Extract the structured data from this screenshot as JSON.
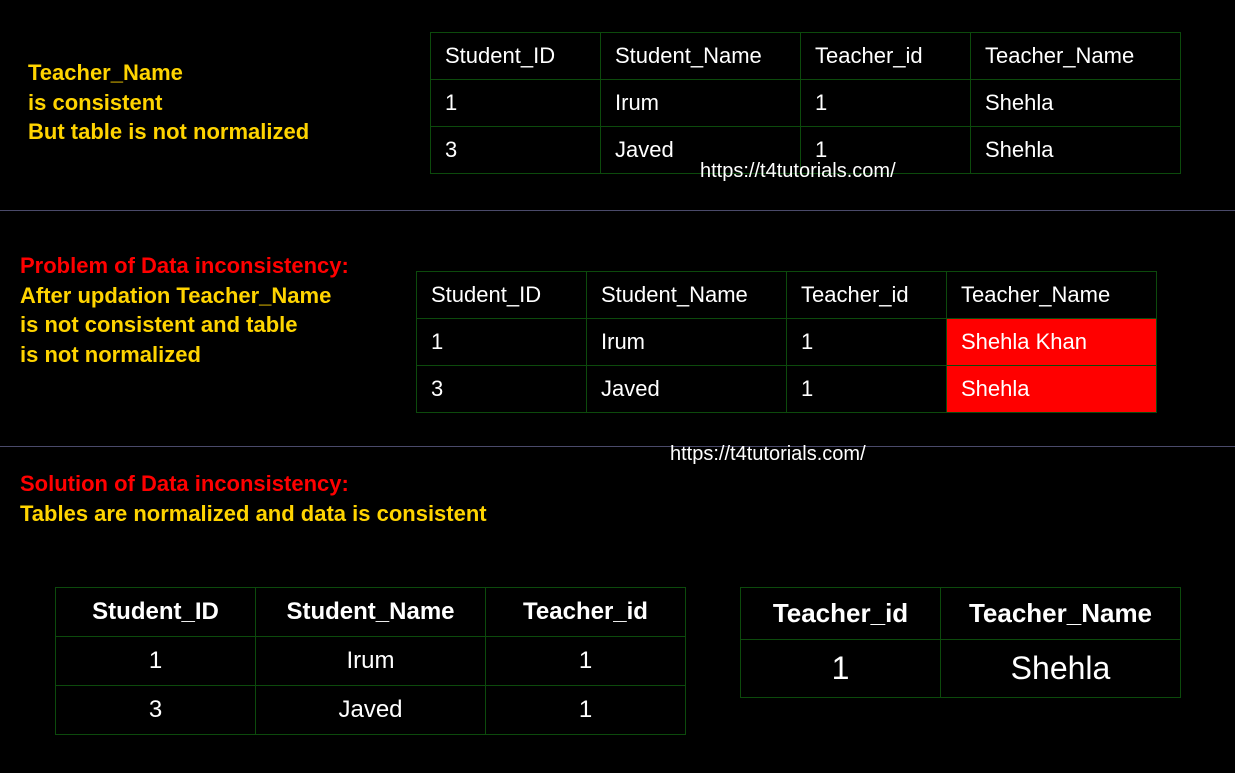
{
  "watermark": "https://t4tutorials.com/",
  "section1": {
    "caption_line1": "Teacher_Name",
    "caption_line2": "is consistent",
    "caption_line3": "But table is not normalized",
    "headers": {
      "c1": "Student_ID",
      "c2": "Student_Name",
      "c3": "Teacher_id",
      "c4": "Teacher_Name"
    },
    "row1": {
      "c1": "1",
      "c2": "Irum",
      "c3": "1",
      "c4": "Shehla"
    },
    "row2": {
      "c1": "3",
      "c2": "Javed",
      "c3": "1",
      "c4": "Shehla"
    }
  },
  "section2": {
    "caption_title": "Problem of Data inconsistency:",
    "caption_line1": "After updation Teacher_Name",
    "caption_line2": "is not consistent and table",
    "caption_line3": "is not normalized",
    "headers": {
      "c1": "Student_ID",
      "c2": "Student_Name",
      "c3": "Teacher_id",
      "c4": "Teacher_Name"
    },
    "row1": {
      "c1": "1",
      "c2": "Irum",
      "c3": "1",
      "c4": "Shehla Khan"
    },
    "row2": {
      "c1": "3",
      "c2": "Javed",
      "c3": "1",
      "c4": "Shehla"
    }
  },
  "section3": {
    "caption_title": "Solution of Data inconsistency:",
    "caption_line1": "Tables are normalized and data is consistent",
    "table_a": {
      "headers": {
        "c1": "Student_ID",
        "c2": "Student_Name",
        "c3": "Teacher_id"
      },
      "row1": {
        "c1": "1",
        "c2": "Irum",
        "c3": "1"
      },
      "row2": {
        "c1": "3",
        "c2": "Javed",
        "c3": "1"
      }
    },
    "table_b": {
      "headers": {
        "c1": "Teacher_id",
        "c2": "Teacher_Name"
      },
      "row1": {
        "c1": "1",
        "c2": "Shehla"
      }
    }
  }
}
